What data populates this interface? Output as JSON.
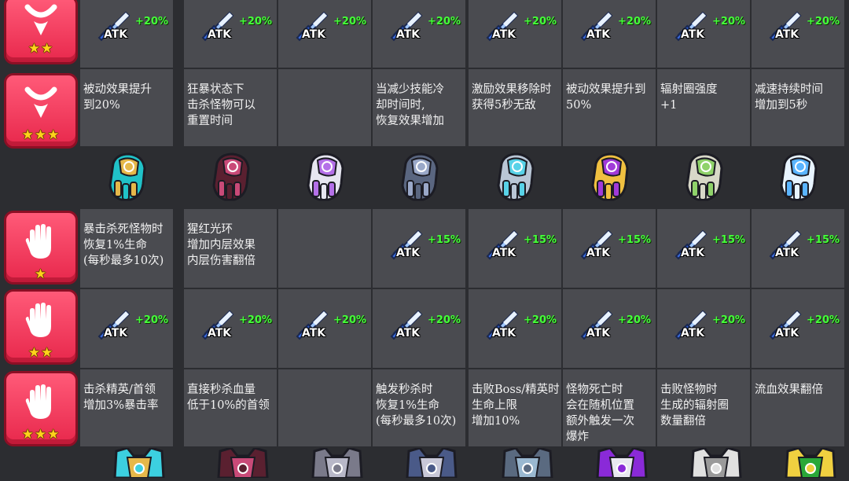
{
  "colors": {
    "badge": "#f03a5a",
    "bonus_green": "#45ff3a",
    "star": "#ffd21c",
    "cell": "#4a4b50"
  },
  "necklace": {
    "tier2": {
      "stars": "★★",
      "icon": "necklace-icon",
      "atk": [
        {
          "label": "ATK",
          "bonus": "+20%"
        },
        {
          "label": "ATK",
          "bonus": "+20%"
        },
        {
          "label": "ATK",
          "bonus": "+20%"
        },
        {
          "label": "ATK",
          "bonus": "+20%"
        },
        {
          "label": "ATK",
          "bonus": "+20%"
        },
        {
          "label": "ATK",
          "bonus": "+20%"
        },
        {
          "label": "ATK",
          "bonus": "+20%"
        },
        {
          "label": "ATK",
          "bonus": "+20%"
        }
      ]
    },
    "tier3": {
      "stars": "★★★",
      "icon": "necklace-icon",
      "effects": [
        "被动效果提升\n到20%",
        "狂暴状态下\n击杀怪物可以\n重置时间",
        "",
        "当减少技能冷\n却时间时,\n恢复效果增加",
        "激励效果移除时\n获得5秒无敌",
        "被动效果提升到\n50%",
        "辐射圈强度\n+1",
        "减速持续时间\n增加到5秒"
      ]
    }
  },
  "gloves_row": {
    "items": [
      "gold-gauntlet",
      "crimson-gauntlet",
      "violet-gauntlet",
      "steel-gauntlet",
      "cyan-gauntlet",
      "purple-gold-gauntlet",
      "emerald-gauntlet",
      "frost-gauntlet"
    ]
  },
  "glove": {
    "tier1": {
      "stars": "★",
      "icon": "glove-icon",
      "effects": [
        "暴击杀死怪物时\n恢复1%生命\n(每秒最多10次)",
        "猩红光环\n增加内层效果\n内层伤害翻倍",
        "",
        "",
        "",
        "",
        "",
        ""
      ],
      "atk": [
        null,
        null,
        null,
        {
          "label": "ATK",
          "bonus": "+15%"
        },
        {
          "label": "ATK",
          "bonus": "+15%"
        },
        {
          "label": "ATK",
          "bonus": "+15%"
        },
        {
          "label": "ATK",
          "bonus": "+15%"
        },
        {
          "label": "ATK",
          "bonus": "+15%"
        }
      ]
    },
    "tier2": {
      "stars": "★★",
      "icon": "glove-icon",
      "atk": [
        {
          "label": "ATK",
          "bonus": "+20%"
        },
        {
          "label": "ATK",
          "bonus": "+20%"
        },
        {
          "label": "ATK",
          "bonus": "+20%"
        },
        {
          "label": "ATK",
          "bonus": "+20%"
        },
        {
          "label": "ATK",
          "bonus": "+20%"
        },
        {
          "label": "ATK",
          "bonus": "+20%"
        },
        {
          "label": "ATK",
          "bonus": "+20%"
        },
        {
          "label": "ATK",
          "bonus": "+20%"
        }
      ]
    },
    "tier3": {
      "stars": "★★★",
      "icon": "glove-icon",
      "effects": [
        "击杀精英/首领\n增加3%暴击率",
        "直接秒杀血量\n低于10%的首领",
        "",
        "触发秒杀时\n恢复1%生命\n(每秒最多10次)",
        "击败Boss/精英时\n生命上限\n增加10%",
        "怪物死亡时\n会在随机位置\n额外触发一次\n爆炸",
        "击败怪物时\n生成的辐射圈\n数量翻倍",
        "流血效果翻倍"
      ]
    }
  },
  "armor_row": {
    "items": [
      "gold-armor",
      "crimson-armor",
      "silver-armor",
      "steel-armor",
      "cyan-armor",
      "purple-armor",
      "emerald-armor",
      "green-armor"
    ]
  }
}
